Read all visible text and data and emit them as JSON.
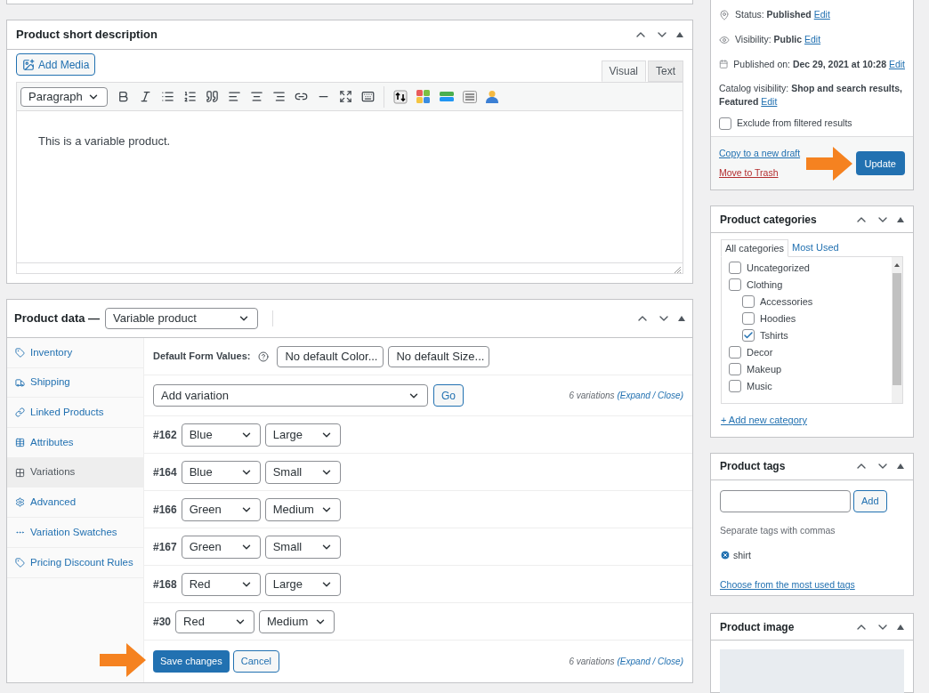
{
  "short_description": {
    "title": "Product short description",
    "add_media": "Add Media",
    "tabs": [
      {
        "label": "Visual",
        "selected": true
      },
      {
        "label": "Text",
        "selected": false
      }
    ],
    "format": "Paragraph",
    "content": "This is a variable product."
  },
  "product_data": {
    "title": "Product data —",
    "type": "Variable product",
    "tabs": [
      {
        "label": "Inventory",
        "selected": false
      },
      {
        "label": "Shipping",
        "selected": false
      },
      {
        "label": "Linked Products",
        "selected": false
      },
      {
        "label": "Attributes",
        "selected": false
      },
      {
        "label": "Variations",
        "selected": true
      },
      {
        "label": "Advanced",
        "selected": false
      },
      {
        "label": "Variation Swatches",
        "selected": false
      },
      {
        "label": "Pricing Discount Rules",
        "selected": false
      }
    ],
    "default_label": "Default Form Values:",
    "defaults": [
      "No default Color...",
      "No default Size..."
    ],
    "add_variation": "Add variation",
    "go": "Go",
    "count": "6 variations",
    "toggle": "(Expand / Close)",
    "variations": [
      {
        "id": "#162",
        "options": [
          "Blue",
          "Large"
        ]
      },
      {
        "id": "#164",
        "options": [
          "Blue",
          "Small"
        ]
      },
      {
        "id": "#166",
        "options": [
          "Green",
          "Medium"
        ]
      },
      {
        "id": "#167",
        "options": [
          "Green",
          "Small"
        ]
      },
      {
        "id": "#168",
        "options": [
          "Red",
          "Large"
        ]
      },
      {
        "id": "#30",
        "options": [
          "Red",
          "Medium"
        ]
      }
    ],
    "save": "Save changes",
    "cancel": "Cancel",
    "footer_count": "6 variations",
    "footer_toggle": "(Expand / Close)"
  },
  "publish": {
    "rows": [
      {
        "label": "Status:",
        "value": "Published",
        "link": "Edit"
      },
      {
        "label": "Visibility:",
        "value": "Public",
        "link": "Edit"
      },
      {
        "label": "Published on:",
        "value": "Dec 29, 2021 at 10:28",
        "link": "Edit"
      }
    ],
    "catalog": {
      "label": "Catalog visibility:",
      "value": "Shop and search results, Featured",
      "link": "Edit"
    },
    "exclude": {
      "label": "Exclude from filtered results",
      "checked": false
    },
    "copy": "Copy to a new draft",
    "trash": "Move to Trash",
    "update": "Update"
  },
  "categories": {
    "title": "Product categories",
    "tabs": [
      {
        "label": "All categories",
        "selected": true
      },
      {
        "label": "Most Used",
        "selected": false
      }
    ],
    "items": [
      {
        "label": "Uncategorized",
        "checked": false
      },
      {
        "label": "Clothing",
        "checked": false,
        "children": [
          {
            "label": "Accessories",
            "checked": false
          },
          {
            "label": "Hoodies",
            "checked": false
          },
          {
            "label": "Tshirts",
            "checked": true
          }
        ]
      },
      {
        "label": "Decor",
        "checked": false
      },
      {
        "label": "Makeup",
        "checked": false
      },
      {
        "label": "Music",
        "checked": false
      }
    ],
    "add": "+ Add new category"
  },
  "tags": {
    "title": "Product tags",
    "add": "Add",
    "hint": "Separate tags with commas",
    "tags": [
      "shirt"
    ],
    "choose": "Choose from the most used tags"
  },
  "image": {
    "title": "Product image"
  }
}
